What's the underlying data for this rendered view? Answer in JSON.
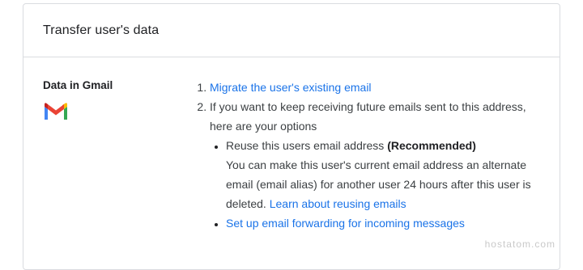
{
  "card": {
    "title": "Transfer user's data"
  },
  "gmail_section": {
    "label": "Data in Gmail",
    "icon": "gmail-icon",
    "steps": [
      {
        "number": "1.",
        "link_text": "Migrate the user's existing email"
      },
      {
        "number": "2.",
        "text": "If you want to keep receiving future emails sent to this address, here are your options"
      }
    ],
    "options": [
      {
        "title": "Reuse this users email address ",
        "tag": "(Recommended)",
        "description": "You can make this user's current email address an alternate email (email alias) for another user 24 hours after this user is deleted. ",
        "link_text": "Learn about reusing emails"
      },
      {
        "link_text": "Set up email forwarding for incoming messages"
      }
    ]
  },
  "watermark": "hostatom.com",
  "colors": {
    "link": "#1a73e8",
    "border": "#dadce0",
    "text": "#202124",
    "body_text": "#3c4043"
  }
}
